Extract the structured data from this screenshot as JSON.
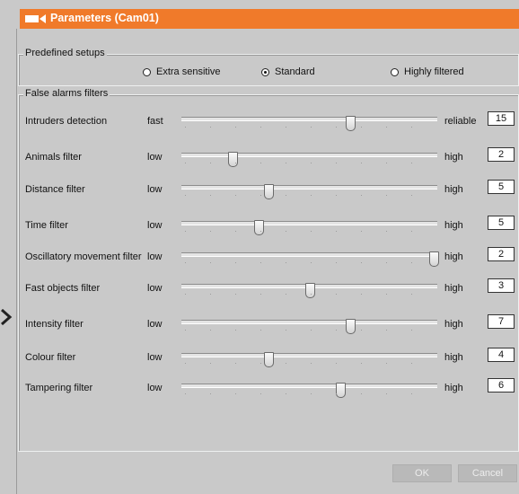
{
  "window": {
    "title": "Parameters (Cam01)"
  },
  "predefined": {
    "legend": "Predefined setups",
    "options": [
      {
        "label": "Extra sensitive",
        "selected": false
      },
      {
        "label": "Standard",
        "selected": true
      },
      {
        "label": "Highly filtered",
        "selected": false
      }
    ]
  },
  "filters": {
    "legend": "False alarms filters",
    "rows": [
      {
        "label": "Intruders detection",
        "low": "fast",
        "high": "reliable",
        "value": "15",
        "level": 0.66
      },
      {
        "label": "Animals filter",
        "low": "low",
        "high": "high",
        "value": "2",
        "level": 0.2
      },
      {
        "label": "Distance filter",
        "low": "low",
        "high": "high",
        "value": "5",
        "level": 0.34
      },
      {
        "label": "Time filter",
        "low": "low",
        "high": "high",
        "value": "5",
        "level": 0.3
      },
      {
        "label": "Oscillatory movement filter",
        "low": "low",
        "high": "high",
        "value": "2",
        "level": 0.985
      },
      {
        "label": "Fast objects filter",
        "low": "low",
        "high": "high",
        "value": "3",
        "level": 0.5
      },
      {
        "label": "Intensity filter",
        "low": "low",
        "high": "high",
        "value": "7",
        "level": 0.66
      },
      {
        "label": "Colour filter",
        "low": "low",
        "high": "high",
        "value": "4",
        "level": 0.34
      },
      {
        "label": "Tampering filter",
        "low": "low",
        "high": "high",
        "value": "6",
        "level": 0.62
      }
    ]
  },
  "buttons": {
    "ok": "OK",
    "cancel": "Cancel"
  },
  "colors": {
    "title_bar": "#f07a2a",
    "background": "#c9c9c9"
  }
}
